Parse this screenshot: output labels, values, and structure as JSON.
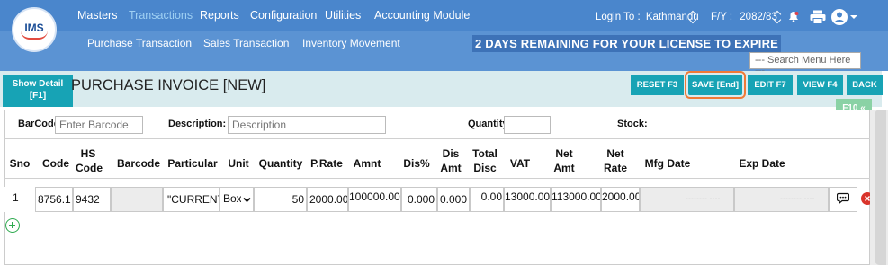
{
  "brand": {
    "logo_text": "IMS"
  },
  "nav": {
    "items": [
      "Masters",
      "Transactions",
      "Reports",
      "Configuration",
      "Utilities",
      "Accounting Module"
    ],
    "active": "Transactions"
  },
  "subnav": {
    "items": [
      "Purchase Transaction",
      "Sales Transaction",
      "Inventory Movement"
    ]
  },
  "license_banner": "2 DAYS REMAINING FOR YOUR LICENSE TO EXPIRE",
  "session": {
    "login_label": "Login To :",
    "login_value": "Kathmandu",
    "fy_label": "F/Y :",
    "fy_value": "2082/83"
  },
  "search_menu": {
    "placeholder": "--- Search Menu Here ---"
  },
  "toolbar": {
    "show_detail_line1": "Show Detail",
    "show_detail_line2": "[F1]",
    "title": "PURCHASE INVOICE [NEW]",
    "reset": "RESET F3",
    "save": "SAVE [End]",
    "edit": "EDIT F7",
    "view": "VIEW F4",
    "back": "BACK",
    "f10": "F10 «"
  },
  "entry": {
    "barcode_label": "BarCode",
    "barcode_placeholder": "Enter Barcode",
    "description_label": "Description:",
    "description_placeholder": "Description",
    "quantity_label": "Quantity",
    "stock_label": "Stock:"
  },
  "table": {
    "headers": [
      "Sno",
      "Code",
      "HS Code",
      "Barcode",
      "Particular",
      "Unit",
      "Quantity",
      "P.Rate",
      "Amnt",
      "Dis%",
      "Dis Amt",
      "Total Disc",
      "VAT",
      "Net Amt",
      "Net Rate",
      "Mfg Date",
      "Exp Date"
    ],
    "rows": [
      {
        "sno": "1",
        "code": "8756.1",
        "hs_code": "9432",
        "barcode": "",
        "particular": "\"CURRENT",
        "unit": "Box",
        "quantity": "50",
        "p_rate": "2000.00",
        "amnt": "100000.00",
        "dis_pct": "0.000",
        "dis_amt": "0.000",
        "total_disc": "0.00",
        "vat": "13000.00",
        "net_amt": "113000.00",
        "net_rate": "2000.00",
        "mfg_date": "-------- ----",
        "exp_date": "-------- ----"
      }
    ]
  },
  "colors": {
    "header_blue": "#4a86cc",
    "subheader_blue": "#5b93d3",
    "button_teal": "#17a3b5",
    "save_outline": "#f07a36",
    "title_bar": "#d9ebee",
    "f10_green": "#8ad2a5",
    "add_green": "#2eaa4f",
    "delete_red": "#d9342b"
  },
  "icons": [
    "bell-icon",
    "printer-icon",
    "user-icon",
    "chevron-down-icon",
    "comment-icon",
    "delete-icon",
    "add-row-icon",
    "chevrons-left-icon"
  ]
}
